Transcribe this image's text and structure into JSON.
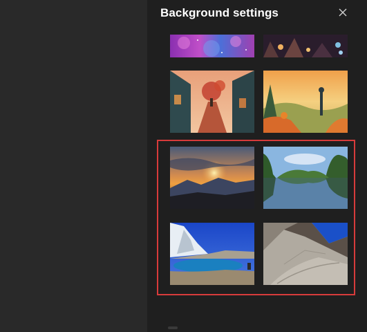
{
  "panel": {
    "title": "Background settings",
    "close_icon": "close-icon",
    "selection_color": "#d83b3b"
  },
  "backgrounds": [
    {
      "name": "galaxy"
    },
    {
      "name": "cave-lanterns"
    },
    {
      "name": "autumn-town-street"
    },
    {
      "name": "fantasy-landscape"
    },
    {
      "name": "mountain-sunset"
    },
    {
      "name": "forest-lake"
    },
    {
      "name": "glacier-lake"
    },
    {
      "name": "rocky-mountain-slope"
    }
  ]
}
